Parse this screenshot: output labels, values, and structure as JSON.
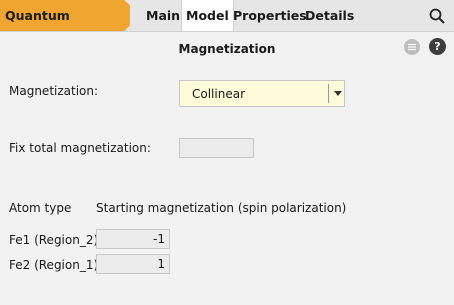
{
  "header": {
    "app_name": "Quantum ESPRESSO",
    "tabs": [
      {
        "label": "Main"
      },
      {
        "label": "Model"
      },
      {
        "label": "Properties"
      },
      {
        "label": "Details"
      }
    ],
    "active_tab": "Model",
    "accent_color": "#f0a530"
  },
  "panel": {
    "title": "Magnetization",
    "magnetization_label": "Magnetization:",
    "magnetization_value": "Collinear",
    "fix_total_label": "Fix total magnetization:",
    "fix_total_value": "",
    "table": {
      "header_atom": "Atom type",
      "header_start": "Starting magnetization (spin polarization)",
      "rows": [
        {
          "atom": "Fe1 (Region_2)",
          "value": "-1"
        },
        {
          "atom": "Fe2 (Region_1)",
          "value": "1"
        }
      ]
    }
  },
  "icons": {
    "search": "search-icon",
    "menu": "menu-icon",
    "help": "help-icon"
  }
}
